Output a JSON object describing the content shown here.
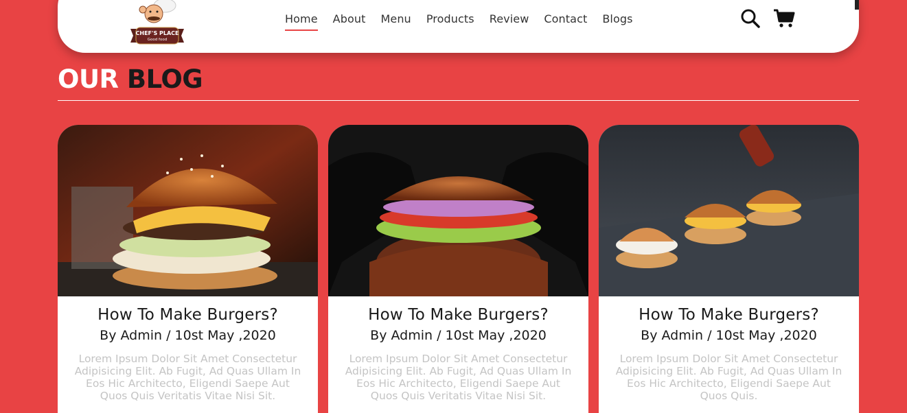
{
  "logo": {
    "line1": "CHEF'S PLACE",
    "line2": "Good food"
  },
  "nav": {
    "items": [
      {
        "label": "Home",
        "active": true
      },
      {
        "label": "About"
      },
      {
        "label": "Menu"
      },
      {
        "label": "Products"
      },
      {
        "label": "Review"
      },
      {
        "label": "Contact"
      },
      {
        "label": "Blogs"
      }
    ],
    "icons": [
      "search-icon",
      "cart-icon"
    ]
  },
  "section": {
    "title_part1": "OUR",
    "title_part2": "BLOG"
  },
  "colors": {
    "accent": "#e84344",
    "dark": "#1a1a1a",
    "muted": "#c4c4c4"
  },
  "blogs": [
    {
      "title": "How To Make Burgers?",
      "meta": "By Admin / 10st May ,2020",
      "text": "Lorem Ipsum Dolor Sit Amet Consectetur Adipisicing Elit. Ab Fugit, Ad Quas Ullam In Eos Hic Architecto, Eligendi Saepe Aut Quos Quis Veritatis Vitae Nisi Sit."
    },
    {
      "title": "How To Make Burgers?",
      "meta": "By Admin / 10st May ,2020",
      "text": "Lorem Ipsum Dolor Sit Amet Consectetur Adipisicing Elit. Ab Fugit, Ad Quas Ullam In Eos Hic Architecto, Eligendi Saepe Aut Quos Quis Veritatis Vitae Nisi Sit."
    },
    {
      "title": "How To Make Burgers?",
      "meta": "By Admin / 10st May ,2020",
      "text": "Lorem Ipsum Dolor Sit Amet Consectetur Adipisicing Elit. Ab Fugit, Ad Quas Ullam In Eos Hic Architecto, Eligendi Saepe Aut Quos Quis."
    }
  ]
}
